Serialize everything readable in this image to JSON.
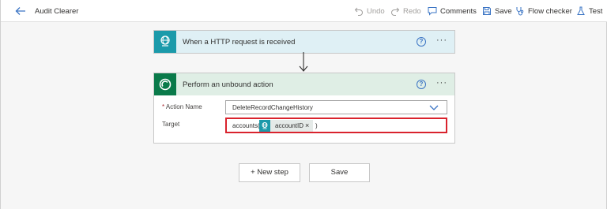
{
  "header": {
    "title": "Audit Clearer",
    "undo_label": "Undo",
    "redo_label": "Redo",
    "comments_label": "Comments",
    "save_label": "Save",
    "flow_checker_label": "Flow checker",
    "test_label": "Test"
  },
  "trigger": {
    "title": "When a HTTP request is received",
    "help": "?",
    "more": "···"
  },
  "action": {
    "title": "Perform an unbound action",
    "help": "?",
    "more": "···",
    "action_name_required": "*",
    "action_name_label": "Action Name",
    "action_name_value": "DeleteRecordChangeHistory",
    "target_label": "Target",
    "target_prefix": "accounts(",
    "target_token": "accountID",
    "target_token_remove": "×",
    "target_suffix": ")"
  },
  "footer": {
    "new_step_label": "+ New step",
    "save_label": "Save"
  },
  "colors": {
    "trigger_accent": "#1b9aaa",
    "action_accent": "#0a7a4a",
    "highlight_border": "#d9232d",
    "link_blue": "#3a74c4"
  },
  "icons": [
    "back-arrow-icon",
    "undo-icon",
    "redo-icon",
    "comment-icon",
    "save-icon",
    "stethoscope-icon",
    "flask-icon",
    "http-globe-icon",
    "dataverse-icon",
    "help-icon",
    "more-icon",
    "down-arrow-icon",
    "chevron-down-icon"
  ]
}
